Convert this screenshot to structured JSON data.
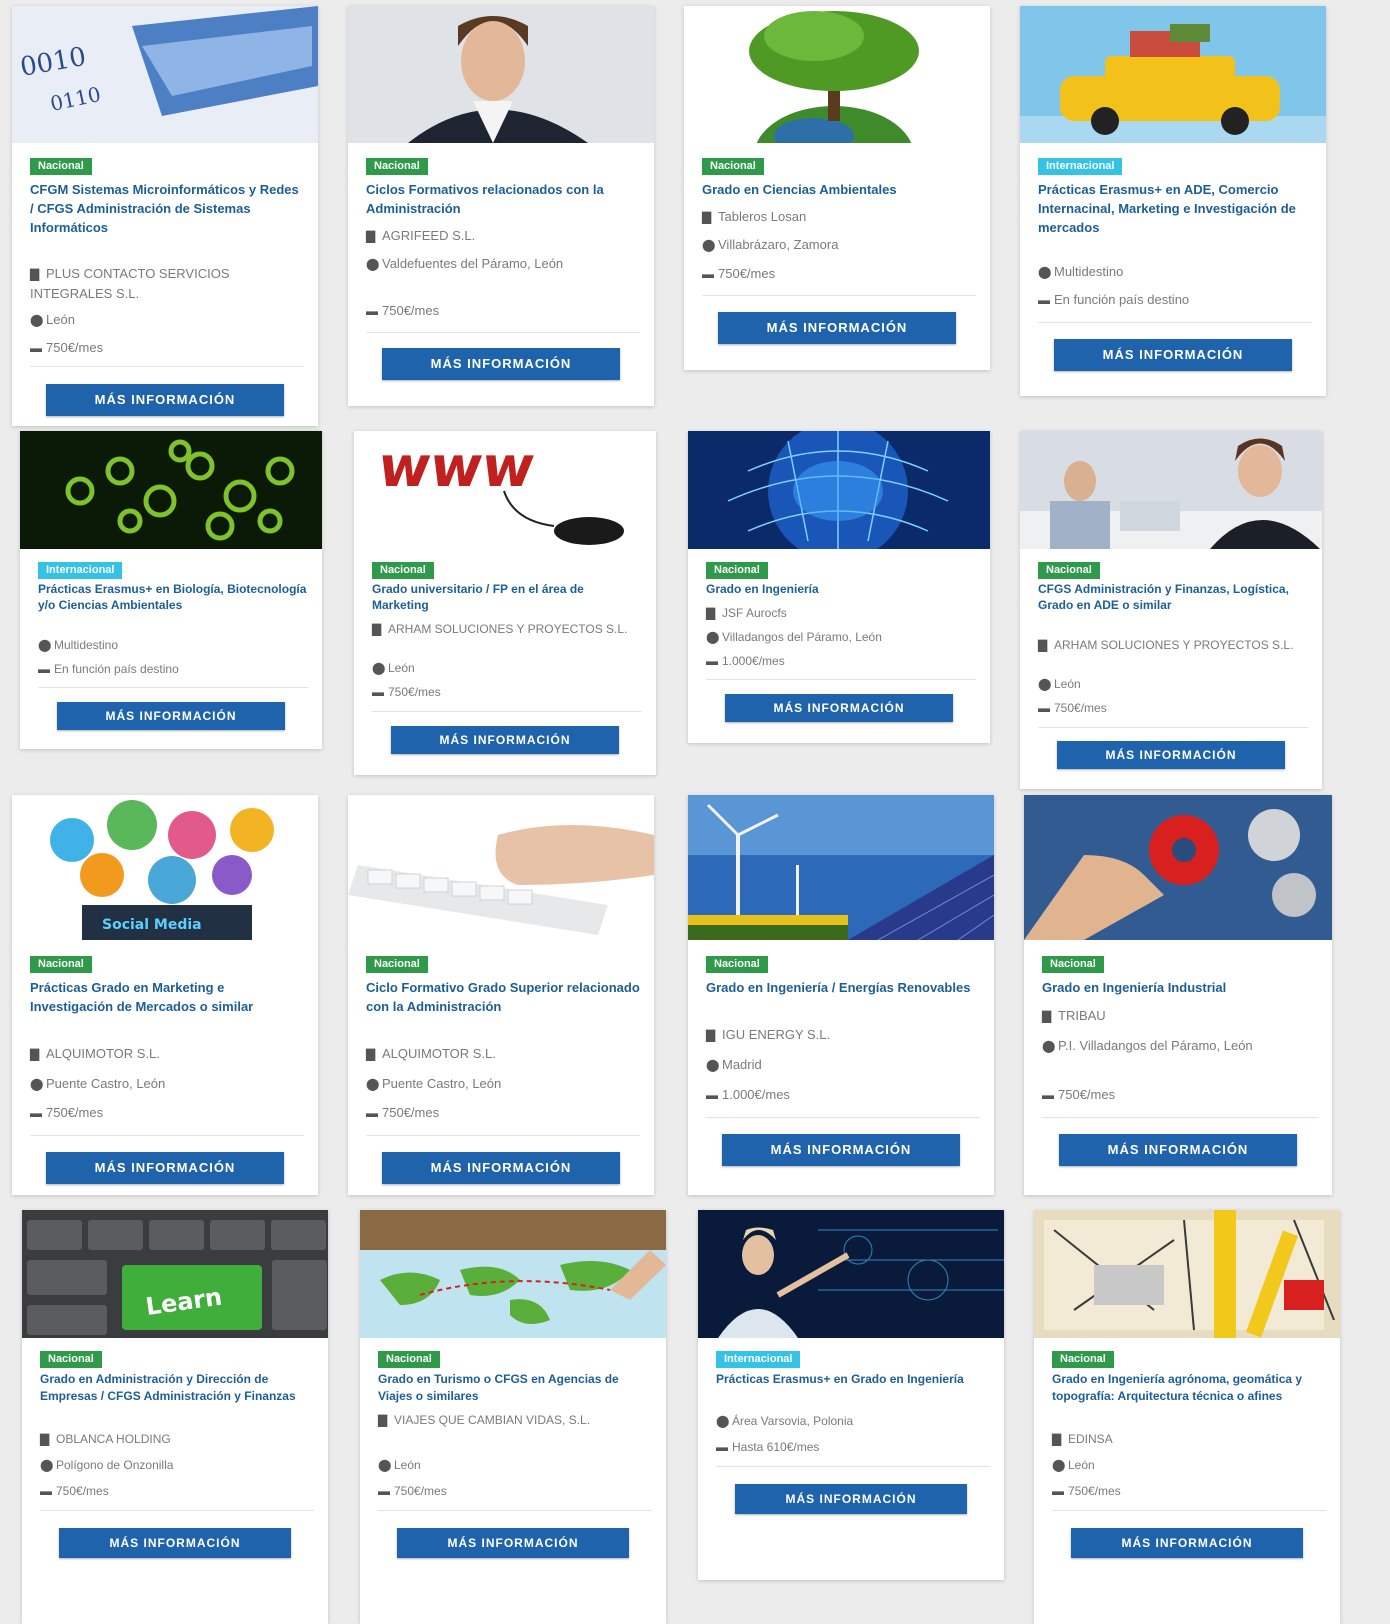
{
  "button_label": "MÁS INFORMACIÓN",
  "badges": {
    "nacional": "Nacional",
    "internacional": "Internacional"
  },
  "colors": {
    "nacional": "#2e9a4a",
    "internacional": "#34c3e6",
    "title": "#1d5e96",
    "button": "#1f63ad"
  },
  "icons": {
    "company": "building-icon",
    "location": "map-pin-icon",
    "salary": "money-icon"
  },
  "cards": [
    {
      "badge": "Nacional",
      "title": "CFGM Sistemas Microinformáticos y Redes / CFGS Administración de Sistemas Informáticos",
      "company": "PLUS CONTACTO SERVICIOS INTEGRALES S.L.",
      "location": "León",
      "salary": "750€/mes",
      "image": "binary-network-cable"
    },
    {
      "badge": "Nacional",
      "title": "Ciclos Formativos relacionados con la Administración",
      "company": "AGRIFEED S.L.",
      "location": "Valdefuentes del Páramo, León",
      "salary": "750€/mes",
      "image": "business-woman"
    },
    {
      "badge": "Nacional",
      "title": "Grado en Ciencias Ambientales",
      "company": "Tableros Losan",
      "location": "Villabrázaro, Zamora",
      "salary": "750€/mes",
      "image": "tree-on-globe"
    },
    {
      "badge": "Internacional",
      "title": "Prácticas Erasmus+ en ADE, Comercio Internacinal, Marketing e Investigación de mercados",
      "company": "",
      "location": "Multidestino",
      "salary": "En función país destino",
      "image": "travel-car"
    },
    {
      "badge": "Internacional",
      "title": "Prácticas Erasmus+ en Biología, Biotecnología y/o Ciencias Ambientales",
      "company": "",
      "location": "Multidestino",
      "salary": "En función país destino",
      "image": "green-cells"
    },
    {
      "badge": "Nacional",
      "title": "Grado universitario / FP en el área de Marketing",
      "company": "ARHAM SOLUCIONES Y PROYECTOS S.L.",
      "location": "León",
      "salary": "750€/mes",
      "image": "www-mouse"
    },
    {
      "badge": "Nacional",
      "title": "Grado en Ingeniería",
      "company": "JSF Aurocfs",
      "location": "Villadangos del Páramo, León",
      "salary": "1.000€/mes",
      "image": "digital-brain"
    },
    {
      "badge": "Nacional",
      "title": "CFGS Administración y Finanzas, Logística, Grado en ADE o similar",
      "company": "ARHAM SOLUCIONES Y PROYECTOS S.L.",
      "location": "León",
      "salary": "750€/mes",
      "image": "office-woman"
    },
    {
      "badge": "Nacional",
      "title": "Prácticas Grado en Marketing e Investigación de Mercados o similar",
      "company": "ALQUIMOTOR S.L.",
      "location": "Puente Castro, León",
      "salary": "750€/mes",
      "image": "social-media"
    },
    {
      "badge": "Nacional",
      "title": "Ciclo Formativo Grado Superior relacionado con la Administración",
      "company": "ALQUIMOTOR S.L.",
      "location": "Puente Castro, León",
      "salary": "750€/mes",
      "image": "keyboard-hand"
    },
    {
      "badge": "Nacional",
      "title": "Grado en Ingeniería / Energías Renovables",
      "company": "IGU ENERGY S.L.",
      "location": "Madrid",
      "salary": "1.000€/mes",
      "image": "wind-solar"
    },
    {
      "badge": "Nacional",
      "title": "Grado en Ingeniería Industrial",
      "company": "TRIBAU",
      "location": "P.I. Villadangos del Páramo, León",
      "salary": "750€/mes",
      "image": "gears-hand"
    },
    {
      "badge": "Nacional",
      "title": "Grado en Administración y Dirección de Empresas / CFGS Administración y Finanzas",
      "company": "OBLANCA HOLDING",
      "location": "Polígono de Onzonilla",
      "salary": "750€/mes",
      "image": "learn-keyboard"
    },
    {
      "badge": "Nacional",
      "title": "Grado en Turismo o CFGS en Agencias de Viajes o similares",
      "company": "VIAJES QUE CAMBIAN VIDAS, S.L.",
      "location": "León",
      "salary": "750€/mes",
      "image": "world-map"
    },
    {
      "badge": "Internacional",
      "title": "Prácticas Erasmus+ en Grado en Ingeniería",
      "company": "",
      "location": "Área Varsovia, Polonia",
      "salary": "Hasta 610€/mes",
      "image": "tech-woman"
    },
    {
      "badge": "Nacional",
      "title": "Grado en Ingeniería agrónoma, geomática y topografía: Arquitectura técnica o afines",
      "company": "EDINSA",
      "location": "León",
      "salary": "750€/mes",
      "image": "architect-tools"
    }
  ]
}
